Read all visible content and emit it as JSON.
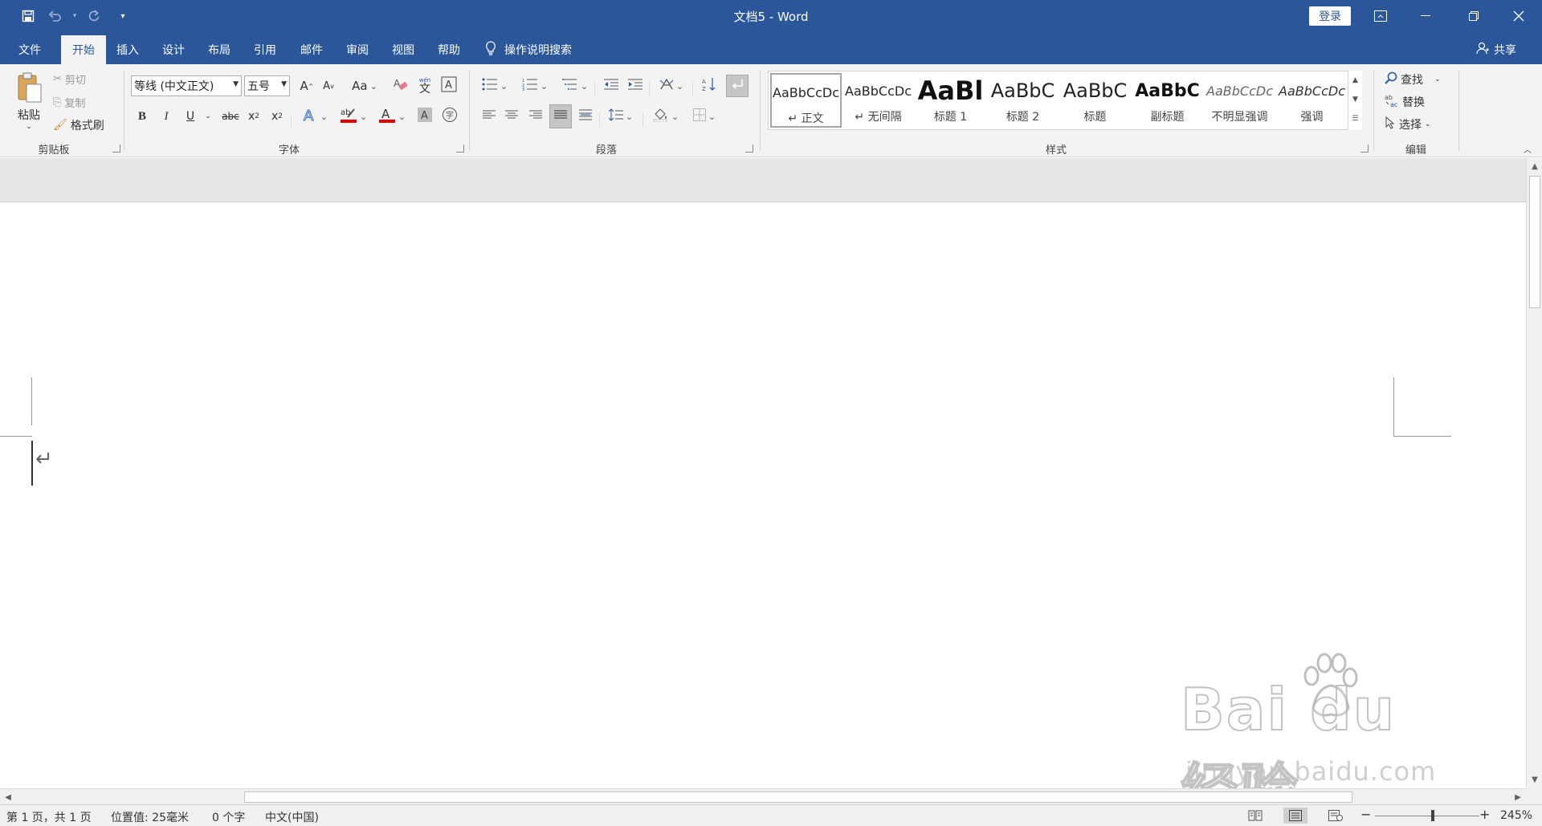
{
  "titlebar": {
    "doc_title": "文档5  -  Word",
    "login_label": "登录",
    "quick_access": [
      "save-icon",
      "undo-icon",
      "redo-icon",
      "customize-icon"
    ]
  },
  "tabs": [
    "文件",
    "开始",
    "插入",
    "设计",
    "布局",
    "引用",
    "邮件",
    "审阅",
    "视图",
    "帮助"
  ],
  "active_tab": "开始",
  "tell_me": "操作说明搜索",
  "share_label": "共享",
  "clipboard": {
    "paste": "粘贴",
    "cut": "剪切",
    "copy": "复制",
    "format_painter": "格式刷",
    "group_label": "剪贴板"
  },
  "font": {
    "family": "等线 (中文正文)",
    "size": "五号",
    "group_label": "字体",
    "bold": "B",
    "italic": "I",
    "underline": "U",
    "strike": "abc",
    "grow": "A",
    "shrink": "A",
    "change_case": "Aa",
    "font_color_label": "A",
    "highlight_label": "ab",
    "wen": "文",
    "wen_pinyin": "wén"
  },
  "paragraph": {
    "group_label": "段落"
  },
  "styles": {
    "group_label": "样式",
    "items": [
      {
        "sample": "AaBbCcDc",
        "name": "↵ 正文"
      },
      {
        "sample": "AaBbCcDc",
        "name": "↵ 无间隔"
      },
      {
        "sample": "AaBl",
        "name": "标题 1"
      },
      {
        "sample": "AaBbC",
        "name": "标题 2"
      },
      {
        "sample": "AaBbC",
        "name": "标题"
      },
      {
        "sample": "AaBbC",
        "name": "副标题"
      },
      {
        "sample": "AaBbCcDc",
        "name": "不明显强调"
      },
      {
        "sample": "AaBbCcDc",
        "name": "强调"
      }
    ]
  },
  "editing": {
    "find": "查找",
    "replace": "替换",
    "select": "选择",
    "group_label": "编辑"
  },
  "document": {
    "paragraph_mark": "↵"
  },
  "watermark": {
    "brand": "Bai du 经验",
    "url": "jingyan.baidu.com"
  },
  "status": {
    "page": "第 1 页，共 1 页",
    "position": "位置值: 25毫米",
    "words": "0 个字",
    "language": "中文(中国)",
    "zoom": "245%",
    "zoom_fraction": 0.55
  },
  "colors": {
    "brand": "#2b579a",
    "font_color": "#e00000",
    "highlight": "#e00000"
  }
}
